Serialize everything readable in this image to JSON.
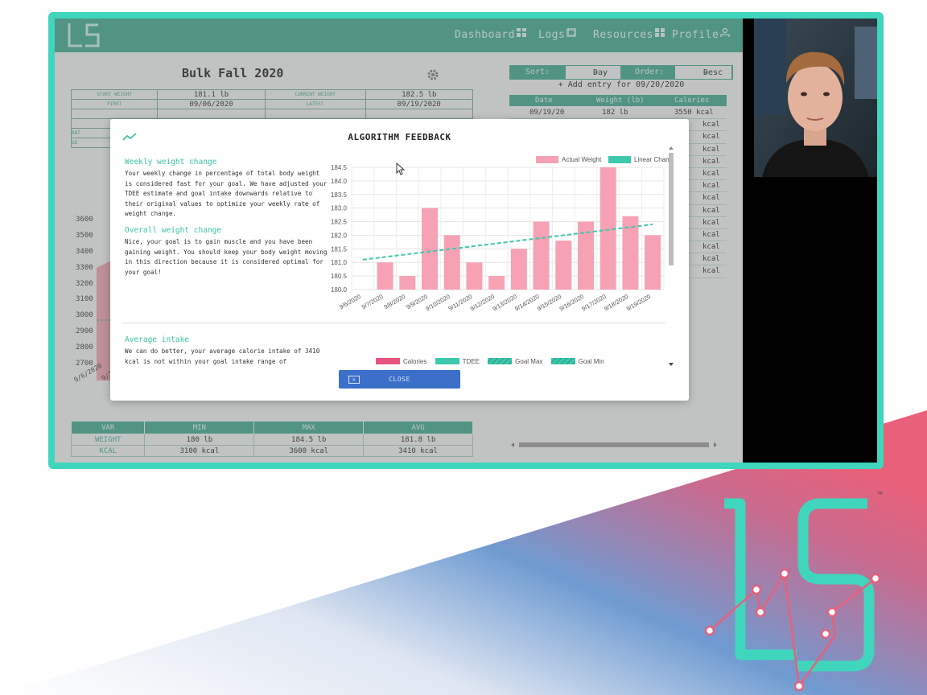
{
  "app": {
    "nav": [
      {
        "label": "Dashboard",
        "icon": "grid-icon"
      },
      {
        "label": "Logs",
        "icon": "logs-icon"
      },
      {
        "label": "Resources",
        "icon": "resources-icon"
      },
      {
        "label": "Profile",
        "icon": "user-icon"
      }
    ],
    "plan_title": "Bulk Fall 2020",
    "info": {
      "start_weight_label": "START WEIGHT",
      "start_weight": "181.1 lb",
      "current_weight_label": "CURRENT WEIGHT",
      "current_weight": "182.5 lb",
      "first_label": "FIRST",
      "first": "09/06/2020",
      "latest_label": "LATEST",
      "latest": "09/19/2020",
      "row5_label": "RAT",
      "row6_label": "GO"
    },
    "bg_chart": {
      "yticks": [
        "3600",
        "3500",
        "3400",
        "3300",
        "3200",
        "3100",
        "3000",
        "2900",
        "2800",
        "2700"
      ],
      "xtick": "9/6/2020",
      "xtick2": "9/7"
    },
    "stats": {
      "headers": [
        "VAR",
        "MIN",
        "MAX",
        "AVG"
      ],
      "rows": [
        [
          "WEIGHT",
          "180 lb",
          "184.5 lb",
          "181.8 lb"
        ],
        [
          "KCAL",
          "3100 kcal",
          "3600 kcal",
          "3410 kcal"
        ]
      ]
    },
    "log": {
      "sort_label": "Sort:",
      "sort_value": "Day",
      "order_label": "Order:",
      "order_value": "Desc",
      "add_entry": "+ Add entry for 09/20/2020",
      "headers": [
        "Date",
        "Weight (lb)",
        "Calories"
      ],
      "first_row": [
        "09/19/20",
        "182 lb",
        "3550 kcal"
      ],
      "kcal_unit": "kcal",
      "row_count": 14
    }
  },
  "modal": {
    "title": "ALGORITHM FEEDBACK",
    "sections": [
      {
        "heading": "Weekly weight change",
        "body": "Your weekly change in percentage of total body weight is considered fast for your goal. We have adjusted your TDEE estimate and goal intake downwards relative to their original values to optimize your weekly rate of weight change."
      },
      {
        "heading": "Overall weight change",
        "body": "Nice, your goal is to gain muscle and you have been gaining weight. You should keep your body weight moving in this direction because it is considered optimal for your goal!"
      },
      {
        "heading": "Average intake",
        "body": "We can do better, your average calorie intake of 3410 kcal is not within your goal intake range of"
      }
    ],
    "close_label": "CLOSE",
    "legend2": [
      {
        "label": "Calories",
        "color": "#e75480"
      },
      {
        "label": "TDEE",
        "color": "#3ec8ad"
      },
      {
        "label": "Goal Max",
        "color": "#3ec8ad"
      },
      {
        "label": "Goal Min",
        "color": "#3ec8ad"
      }
    ]
  },
  "chart_data": {
    "type": "bar",
    "categories": [
      "9/6/2020",
      "9/7/2020",
      "9/8/2020",
      "9/9/2020",
      "9/10/2020",
      "9/11/2020",
      "9/12/2020",
      "9/13/2020",
      "9/14/2020",
      "9/15/2020",
      "9/16/2020",
      "9/17/2020",
      "9/18/2020",
      "9/19/2020"
    ],
    "series": [
      {
        "name": "Actual Weight",
        "type": "bar",
        "color": "#f7a1b5",
        "values": [
          null,
          181.0,
          180.5,
          183.0,
          182.0,
          181.0,
          180.5,
          181.5,
          182.5,
          181.8,
          182.5,
          184.5,
          182.7,
          182.0
        ]
      },
      {
        "name": "Linear Change",
        "type": "line",
        "dashed": true,
        "color": "#3ec8ad",
        "values": [
          181.1,
          181.2,
          181.3,
          181.4,
          181.5,
          181.6,
          181.7,
          181.8,
          181.9,
          182.0,
          182.1,
          182.2,
          182.3,
          182.4
        ]
      }
    ],
    "ylim": [
      180.0,
      184.5
    ],
    "yticks": [
      "184.5",
      "184.0",
      "183.5",
      "183.0",
      "182.5",
      "182.0",
      "181.5",
      "181.0",
      "180.5",
      "180.0"
    ],
    "title": "",
    "xlabel": "",
    "ylabel": "",
    "grid": true,
    "legend_position": "top-center"
  },
  "colors": {
    "accent": "#3fd6bd",
    "app_green": "#3aa58c",
    "close_blue": "#3b6fc9",
    "logo_pink": "#e8607a"
  },
  "brand": {
    "tm": "™"
  }
}
